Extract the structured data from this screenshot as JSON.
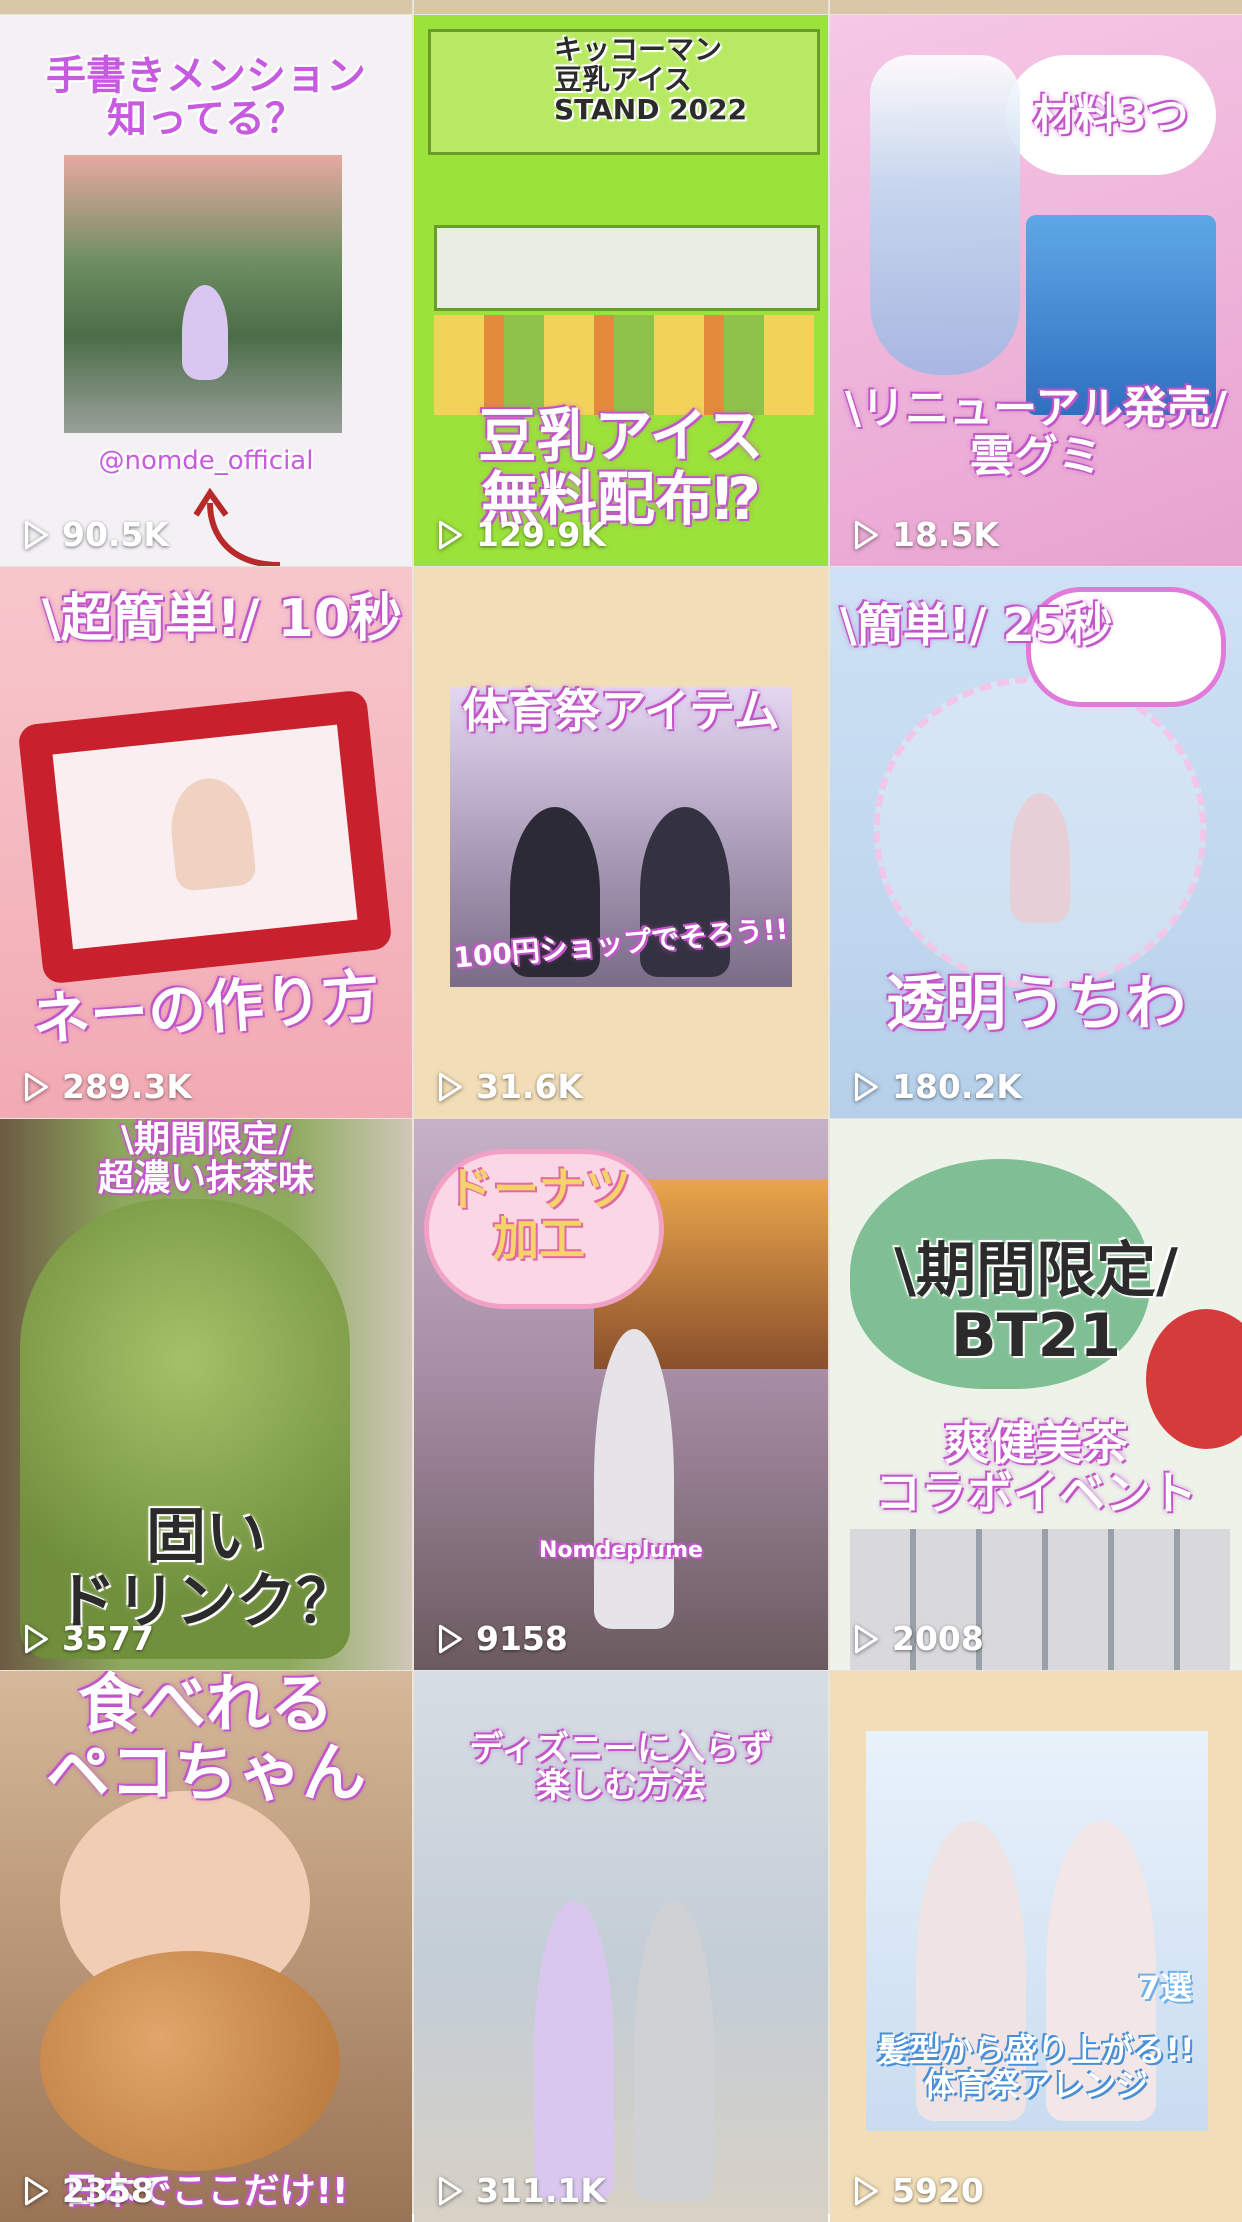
{
  "grid": {
    "videos": [
      {
        "caption_top": "手書きメンション\n知ってる？",
        "caption_bottom": "@nomde_official",
        "views": "90.5K",
        "bg": "#f3f1f4",
        "accent": "#b565f0"
      },
      {
        "caption_top": "キッコーマン\n豆乳アイス\nSTAND 2022",
        "caption_bottom": "豆乳アイス\n無料配布⁉",
        "views": "129.9K",
        "bg": "#9be23a",
        "accent": "#e58ce8"
      },
      {
        "caption_top": "材料3つ",
        "caption_bottom": "\\リニューアル発売/\n雲グミ",
        "views": "18.5K",
        "bg": "#f1b9de",
        "accent": "#e07ad7"
      },
      {
        "caption_top": "\\超簡単!/ 10秒",
        "caption_bottom": "ネーの作り方",
        "views": "289.3K",
        "bg": "#f5c0c7",
        "accent": "#d83a64"
      },
      {
        "caption_top": "体育祭アイテム",
        "caption_bottom": "100円ショップでそろう!!",
        "views": "31.6K",
        "bg": "#f1ddb7",
        "accent": "#b86ad6"
      },
      {
        "caption_top": "\\簡単!/ 25秒",
        "caption_bottom": "透明うちわ",
        "views": "180.2K",
        "bg": "#c9dff3",
        "accent": "#d45fdd"
      },
      {
        "caption_top": "\\期間限定/\n超濃い抹茶味",
        "caption_bottom": "固い\nドリンク？",
        "views": "3577",
        "bg": "#8eaa5d",
        "accent": "#d873e0"
      },
      {
        "caption_top": "ドーナツ\n加工",
        "caption_bottom": "Nomdeplume",
        "views": "9158",
        "bg": "#b7a7b9",
        "accent": "#e89bd4"
      },
      {
        "caption_top": "\\期間限定/\nBT21",
        "caption_bottom": "爽健美茶\nコラボイベント",
        "views": "2008",
        "bg": "#dbe8d6",
        "accent": "#e27ad9"
      },
      {
        "caption_top": "食べれる\nペコちゃん",
        "caption_bottom": "日本でここだけ!!",
        "views": "2358",
        "bg": "#e9c9a9",
        "accent": "#e76dd2"
      },
      {
        "caption_top": "ディズニーに入らず\n楽しむ方法",
        "caption_bottom": "",
        "views": "311.1K",
        "bg": "#c8d3de",
        "accent": "#d97be0"
      },
      {
        "caption_top": "7選",
        "caption_bottom": "髪型から盛り上がる!!\n体育祭アレンジ",
        "views": "5920",
        "bg": "#f1ddb7",
        "accent": "#6fb0ea"
      }
    ]
  }
}
